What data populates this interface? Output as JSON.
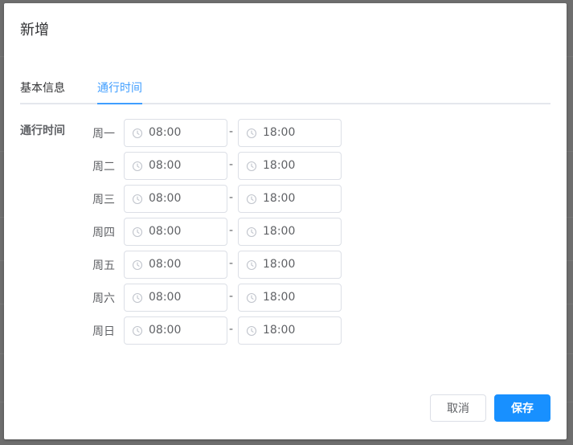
{
  "dialog": {
    "title": "新增"
  },
  "tabs": [
    {
      "label": "基本信息",
      "active": false
    },
    {
      "label": "通行时间",
      "active": true
    }
  ],
  "section": {
    "label": "通行时间"
  },
  "schedule": [
    {
      "day": "周一",
      "start": "08:00",
      "separator": "-",
      "end": "18:00"
    },
    {
      "day": "周二",
      "start": "08:00",
      "separator": "-",
      "end": "18:00"
    },
    {
      "day": "周三",
      "start": "08:00",
      "separator": "-",
      "end": "18:00"
    },
    {
      "day": "周四",
      "start": "08:00",
      "separator": "-",
      "end": "18:00"
    },
    {
      "day": "周五",
      "start": "08:00",
      "separator": "-",
      "end": "18:00"
    },
    {
      "day": "周六",
      "start": "08:00",
      "separator": "-",
      "end": "18:00"
    },
    {
      "day": "周日",
      "start": "08:00",
      "separator": "-",
      "end": "18:00"
    }
  ],
  "footer": {
    "cancel_label": "取消",
    "save_label": "保存"
  },
  "icons": {
    "time": "clock-icon"
  },
  "colors": {
    "accent": "#409eff",
    "primary_button": "#1890ff",
    "text": "#606266"
  }
}
